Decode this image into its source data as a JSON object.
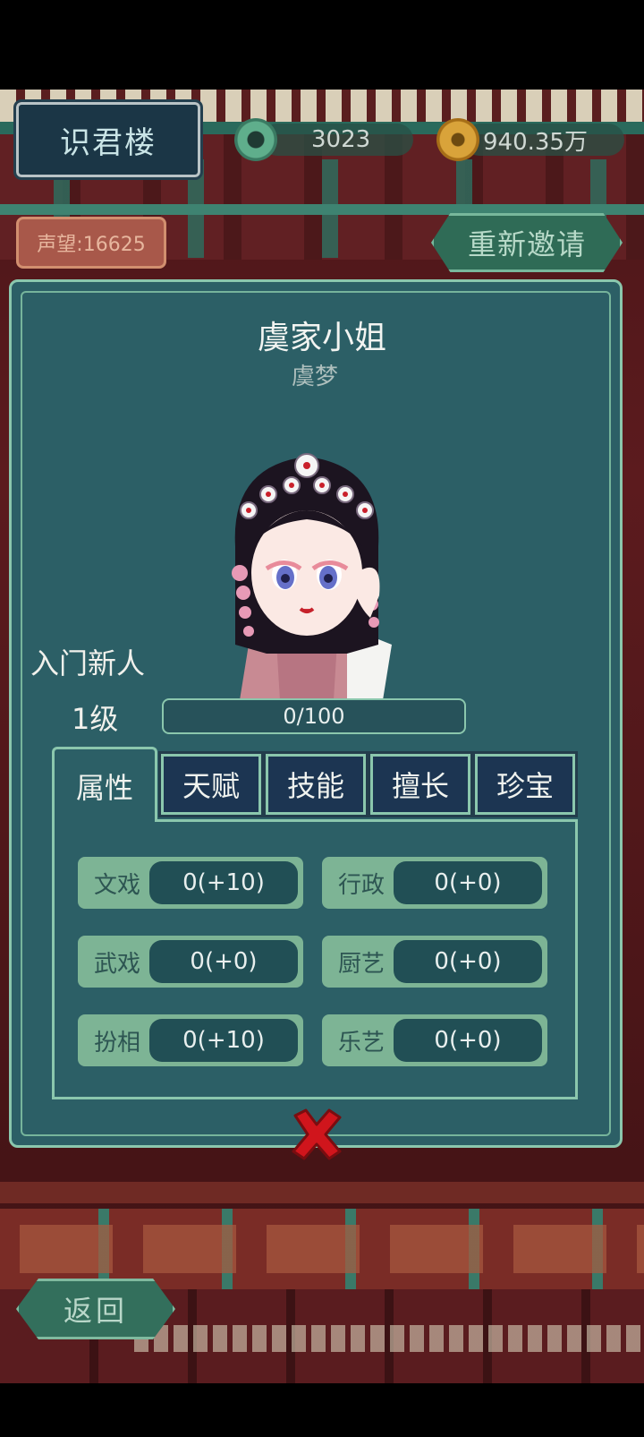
{
  "header": {
    "location_title": "识君楼",
    "jade_amount": "3023",
    "copper_amount": "940.35万",
    "reputation": "声望:16625",
    "reinvite_label": "重新邀请"
  },
  "character": {
    "title": "虞家小姐",
    "name": "虞梦",
    "rank": "入门新人",
    "level": "1级",
    "xp_text": "0/100",
    "xp_fraction": 0
  },
  "tabs": [
    {
      "label": "属性"
    },
    {
      "label": "天赋"
    },
    {
      "label": "技能"
    },
    {
      "label": "擅长"
    },
    {
      "label": "珍宝"
    }
  ],
  "stats": [
    {
      "label": "文戏",
      "value": "0(+10)"
    },
    {
      "label": "行政",
      "value": "0(+0)"
    },
    {
      "label": "武戏",
      "value": "0(+0)"
    },
    {
      "label": "厨艺",
      "value": "0(+0)"
    },
    {
      "label": "扮相",
      "value": "0(+10)"
    },
    {
      "label": "乐艺",
      "value": "0(+0)"
    }
  ],
  "footer": {
    "back_label": "返回"
  },
  "icons": {
    "jade": "jade-disc-icon",
    "copper": "copper-coin-icon",
    "close": "close-icon"
  },
  "colors": {
    "dialog_bg": "#2c5f66",
    "dialog_border": "#8bc7ad",
    "tab_bg": "#1c3552",
    "stat_bg": "#7db495",
    "close_red": "#d0151c"
  }
}
